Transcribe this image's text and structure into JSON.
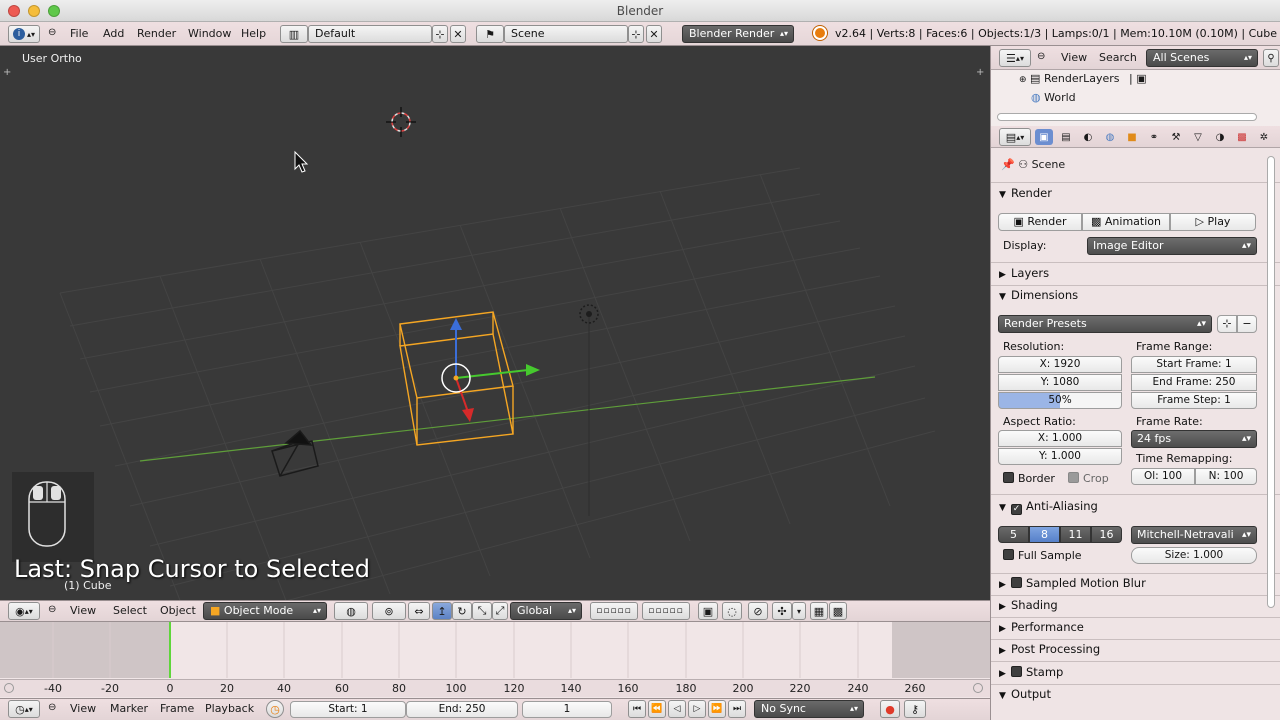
{
  "window": {
    "title": "Blender"
  },
  "main_header": {
    "menus": [
      "File",
      "Add",
      "Render",
      "Window",
      "Help"
    ],
    "screen_layout": "Default",
    "scene": "Scene",
    "render_engine": "Blender Render",
    "stats": "v2.64 | Verts:8 | Faces:6 | Objects:1/3 | Lamps:0/1 | Mem:10.10M (0.10M) | Cube"
  },
  "viewport": {
    "view_label": "User Ortho",
    "last_operator": "Last: Snap Cursor to Selected",
    "object_label": "(1) Cube"
  },
  "viewport_header": {
    "menus": [
      "View",
      "Select",
      "Object"
    ],
    "mode": "Object Mode",
    "orientation": "Global"
  },
  "timeline": {
    "ticks": [
      "-40",
      "-20",
      "0",
      "20",
      "40",
      "60",
      "80",
      "100",
      "120",
      "140",
      "160",
      "180",
      "200",
      "220",
      "240",
      "260"
    ],
    "menus": [
      "View",
      "Marker",
      "Frame",
      "Playback"
    ],
    "start": "Start: 1",
    "end": "End: 250",
    "current": "1",
    "sync": "No Sync"
  },
  "outliner": {
    "menus": [
      "View",
      "Search"
    ],
    "filter": "All Scenes",
    "items": [
      "RenderLayers",
      "World"
    ]
  },
  "properties": {
    "breadcrumb": "Scene",
    "render_section": "Render",
    "render_btn": "Render",
    "animation_btn": "Animation",
    "play_btn": "Play",
    "display_label": "Display:",
    "display_value": "Image Editor",
    "layers_section": "Layers",
    "dimensions_section": "Dimensions",
    "render_presets": "Render Presets",
    "resolution_label": "Resolution:",
    "res_x": "X: 1920",
    "res_y": "Y: 1080",
    "res_pct": "50%",
    "frame_range_label": "Frame Range:",
    "start_frame": "Start Frame: 1",
    "end_frame": "End Frame: 250",
    "frame_step": "Frame Step: 1",
    "aspect_label": "Aspect Ratio:",
    "aspect_x": "X: 1.000",
    "aspect_y": "Y: 1.000",
    "frame_rate_label": "Frame Rate:",
    "frame_rate": "24 fps",
    "border_label": "Border",
    "crop_label": "Crop",
    "time_remap_label": "Time Remapping:",
    "remap_old": "Ol: 100",
    "remap_new": "N: 100",
    "aa_section": "Anti-Aliasing",
    "aa_samples": [
      "5",
      "8",
      "11",
      "16"
    ],
    "aa_filter": "Mitchell-Netravali",
    "full_sample_label": "Full Sample",
    "aa_size": "Size: 1.000",
    "motion_blur_section": "Sampled Motion Blur",
    "shading_section": "Shading",
    "performance_section": "Performance",
    "post_processing_section": "Post Processing",
    "stamp_section": "Stamp",
    "output_section": "Output"
  },
  "colors": {
    "header_bg": "#efdfe1",
    "viewport_bg": "#393939",
    "selection_orange": "#f5a623",
    "axis_green": "#6fbf40",
    "accent_blue": "#5680c9"
  }
}
